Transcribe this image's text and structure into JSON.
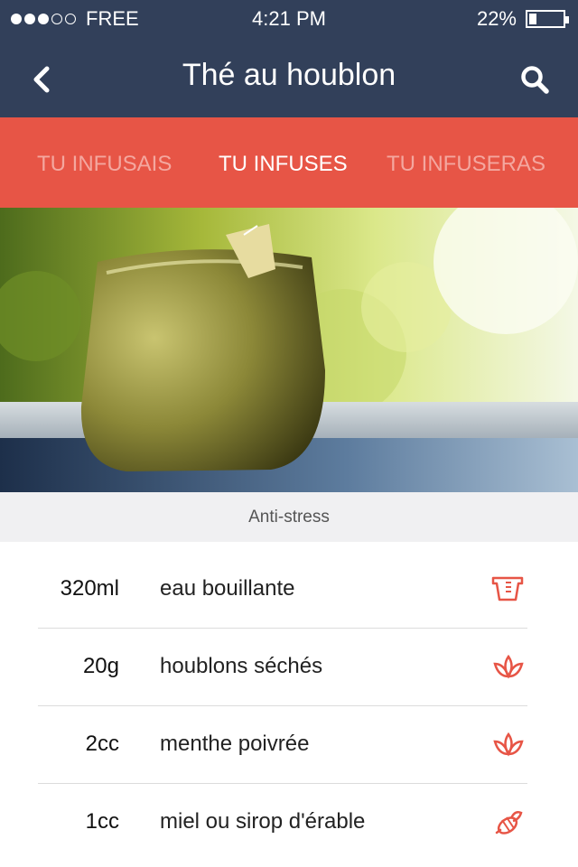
{
  "status": {
    "carrier": "FREE",
    "signal_bars": 3,
    "signal_max": 5,
    "time": "4:21 PM",
    "battery_text": "22%",
    "battery_level": 0.22
  },
  "navbar": {
    "title": "Thé au houblon",
    "back_icon": "chevron-left-icon",
    "search_icon": "search-icon",
    "bg": "#32405a"
  },
  "tabs": {
    "bg": "#e75546",
    "items": [
      {
        "label": "TU INFUSAIS",
        "active": false
      },
      {
        "label": "TU INFUSES",
        "active": true
      },
      {
        "label": "TU INFUSERAS",
        "active": false
      }
    ]
  },
  "photo": {
    "subject": "tea cup with tea bag by window"
  },
  "caption": "Anti-stress",
  "ingredients": [
    {
      "qty": "320ml",
      "name": "eau bouillante",
      "icon": "measuring-cup-icon"
    },
    {
      "qty": "20g",
      "name": "houblons séchés",
      "icon": "lotus-icon"
    },
    {
      "qty": "2cc",
      "name": "menthe poivrée",
      "icon": "lotus-icon"
    },
    {
      "qty": "1cc",
      "name": "miel ou sirop d'érable",
      "icon": "bee-icon"
    }
  ],
  "accent": "#e75546"
}
